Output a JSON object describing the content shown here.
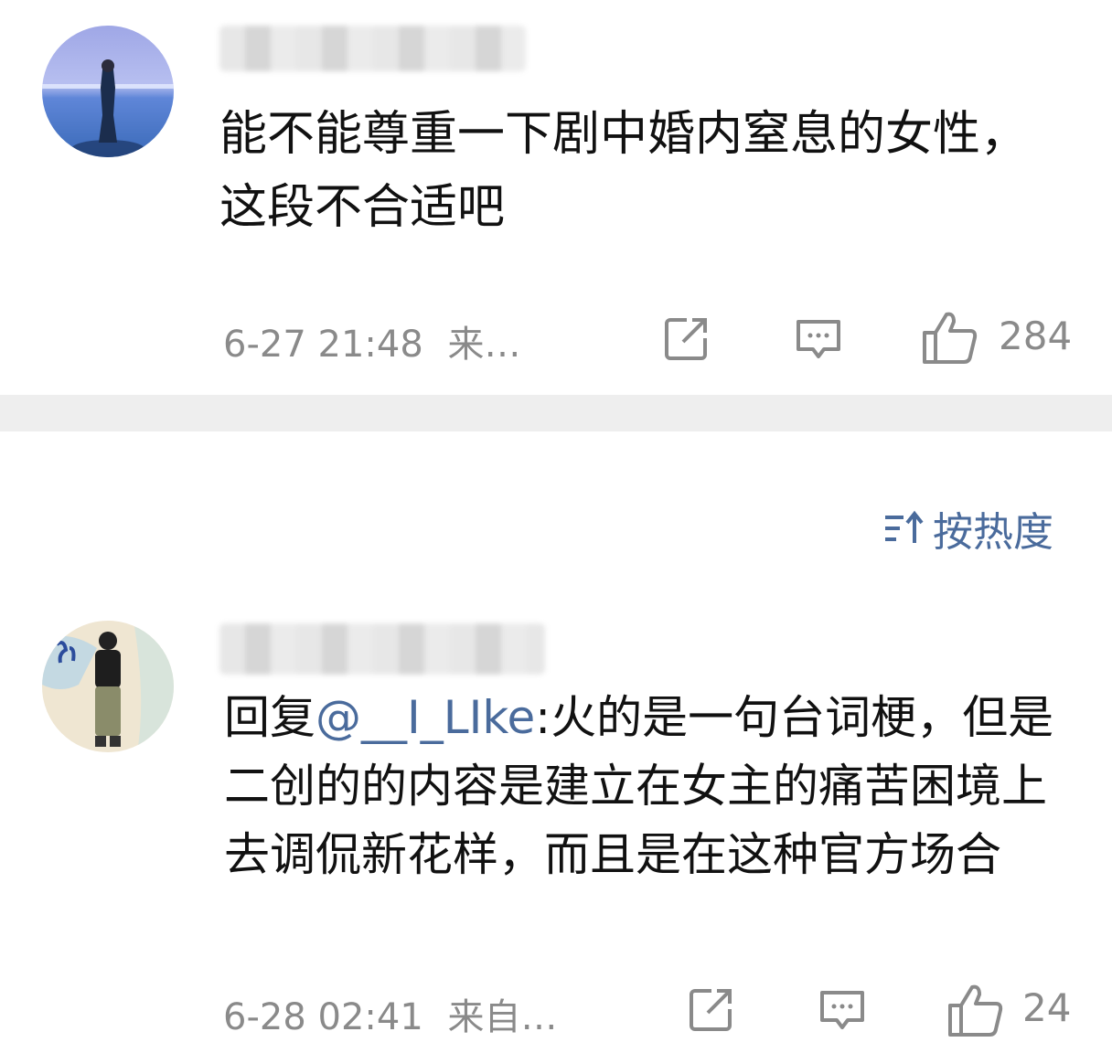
{
  "comments": [
    {
      "text": "能不能尊重一下剧中婚内窒息的女性，这段不合适吧",
      "time": "6-27 21:48",
      "source": "来…",
      "likes": "284",
      "avatar_icon": "avatar-woman-by-sea-icon"
    },
    {
      "reply_prefix": "回复",
      "mention": "@__I_LIke",
      "text": ":火的是一句台词梗，但是二创的的内容是建立在女主的痛苦困境上去调侃新花样，而且是在这种官方场合",
      "time": "6-28 02:41",
      "source": "来自…",
      "likes": "24",
      "avatar_icon": "avatar-person-standing-icon"
    }
  ],
  "sort": {
    "label": "按热度",
    "icon": "sort-icon"
  },
  "colors": {
    "link": "#4a6b9c",
    "meta": "#8a8a8a",
    "divider": "#eeeeee",
    "text": "#111111"
  }
}
